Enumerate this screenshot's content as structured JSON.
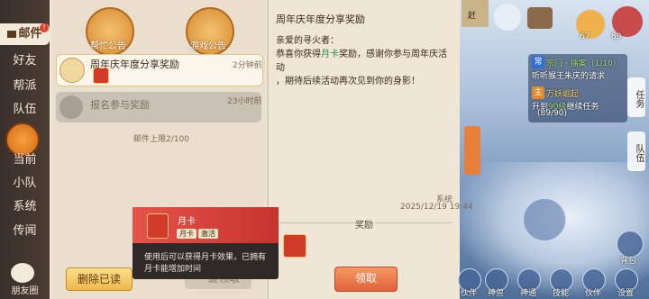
{
  "sidebar": {
    "items": [
      {
        "label": "邮件"
      },
      {
        "label": "好友"
      },
      {
        "label": "帮派"
      },
      {
        "label": "队伍"
      },
      {
        "label": "当前"
      },
      {
        "label": "小队"
      },
      {
        "label": "系统"
      },
      {
        "label": "传闻"
      }
    ],
    "friends_label": "朋友圈",
    "mail_badge": "!"
  },
  "notices": {
    "help_label": "帮忙公告",
    "rules_label": "游戏公告"
  },
  "mail_list": [
    {
      "title": "周年庆年度分享奖励",
      "time": "2分钟前"
    },
    {
      "title": "报名参与奖励",
      "time": "23小时前"
    }
  ],
  "mail_limit": "邮件上限2/100",
  "buttons": {
    "delete_read": "删除已读",
    "claim_all": "一键领取",
    "claim": "领取"
  },
  "detail": {
    "title": "周年庆年度分享奖励",
    "greeting": "亲爱的寻火者：",
    "body_pre": "恭喜你获得",
    "body_hl": "月卡",
    "body_post": "奖励，感谢你参与周年庆活动",
    "body_line2": "，期待后续活动再次见到你的身影！",
    "sender": "系统",
    "date": "2025/12/19 19:44",
    "reward_label": "奖励"
  },
  "tooltip": {
    "name": "月卡",
    "tag1": "月卡",
    "tag2": "激活",
    "desc_line1": "使用后可以获得月卡效果，已拥有",
    "desc_line2": "月卡能增加时间"
  },
  "hud": {
    "top_right_level": "89",
    "top_left_level": "67",
    "quest_tag1": "常",
    "quest_title1": "宗门 · 擂案（1/10）",
    "quest_desc1": "听听猴王朱庆的请求",
    "quest_tag2": "主",
    "quest_title2": "万妖崛起",
    "quest_desc2_pre": "升到",
    "quest_desc2_hl": "90级",
    "quest_desc2_post": "继续任务",
    "quest_progress": "(89/90)",
    "tab_task": "任务",
    "tab_team": "队伍",
    "rush_label": "赶",
    "bag_label": "背包",
    "bottom_labels": [
      "伙伴",
      "神兽",
      "神通",
      "技能",
      "伙伴",
      "设置"
    ]
  }
}
